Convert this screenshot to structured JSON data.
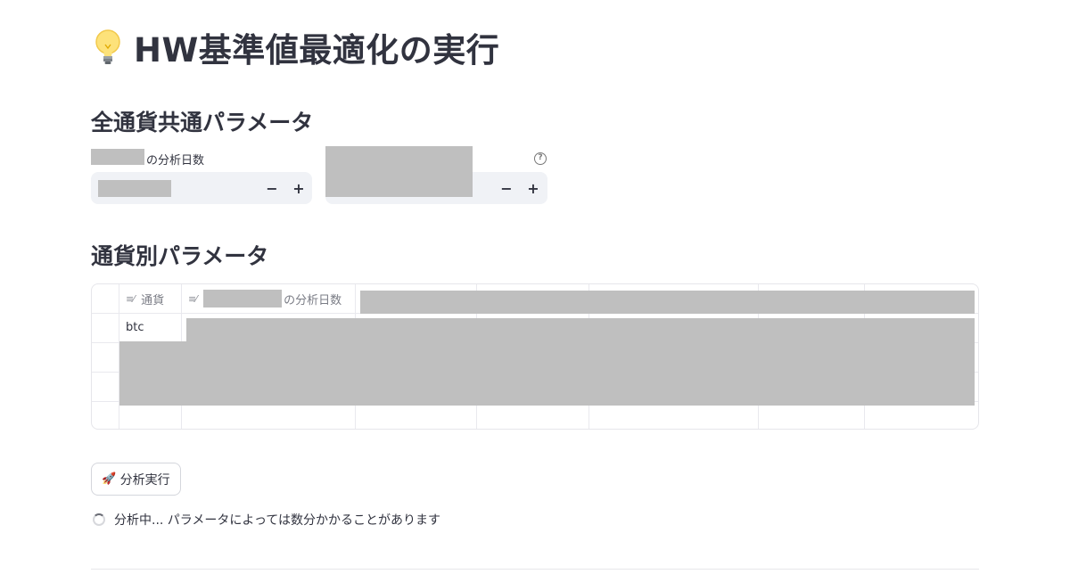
{
  "page": {
    "title": "HW基準値最適化の実行",
    "title_icon": "lightbulb-icon"
  },
  "common_section": {
    "heading": "全通貨共通パラメータ",
    "field1": {
      "label_suffix": "の分析日数",
      "step_down": "−",
      "step_up": "+"
    },
    "field2": {
      "help_icon": "?",
      "step_down": "−",
      "step_up": "+"
    }
  },
  "currency_section": {
    "heading": "通貨別パラメータ",
    "table": {
      "columns": [
        {
          "type_icon": "text-column-icon",
          "label": "通貨"
        },
        {
          "type_icon": "text-column-icon",
          "label_suffix": "の分析日数"
        }
      ],
      "rows": [
        {
          "currency": "btc"
        }
      ]
    }
  },
  "run_button": {
    "icon": "rocket-icon",
    "label": "分析実行"
  },
  "status": {
    "text": "分析中... パラメータによっては数分かかることがあります"
  }
}
